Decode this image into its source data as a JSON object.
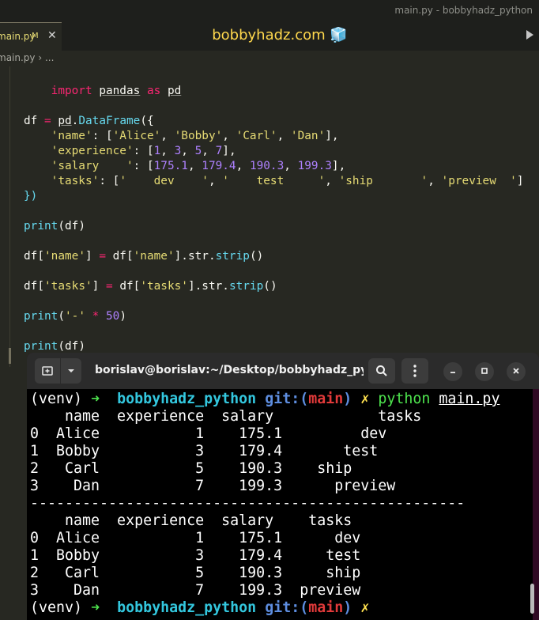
{
  "window": {
    "title": "main.py - bobbyhadz_python"
  },
  "tab": {
    "label": "main.py",
    "modified": "M",
    "close": "✕"
  },
  "brand": "bobbyhadz.com 🧊",
  "breadcrumb": "main.py › ...",
  "code": {
    "l1": [
      "import",
      "pandas",
      "as",
      "pd"
    ],
    "l4a": "df",
    "l4b": "=",
    "l4c": "pd",
    "l4d": ".",
    "l4e": "DataFrame",
    "l4f": "({",
    "l5": [
      "'name'",
      ": [",
      "'Alice'",
      ", ",
      "'Bobby'",
      ", ",
      "'Carl'",
      ", ",
      "'Dan'",
      "],"
    ],
    "l6": [
      "'experience'",
      ": [",
      "1",
      ", ",
      "3",
      ", ",
      "5",
      ", ",
      "7",
      "],"
    ],
    "l7": [
      "'salary    '",
      ": [",
      "175.1",
      ", ",
      "179.4",
      ", ",
      "190.3",
      ", ",
      "199.3",
      "],"
    ],
    "l8": [
      "'tasks'",
      ": [",
      "'    dev    '",
      ", ",
      "'    test     '",
      ", ",
      "'ship       '",
      ", ",
      "'preview  '",
      "]"
    ],
    "l9": "})",
    "l11": [
      "print",
      "(df)"
    ],
    "l13": [
      "df[",
      "'name'",
      "] ",
      "=",
      " df[",
      "'name'",
      "].str.",
      "strip",
      "()"
    ],
    "l15": [
      "df[",
      "'tasks'",
      "] ",
      "=",
      " df[",
      "'tasks'",
      "].str.",
      "strip",
      "()"
    ],
    "l17": [
      "print",
      "(",
      "'-'",
      " ",
      "*",
      " ",
      "50",
      ")"
    ],
    "l19": [
      "print",
      "(df)"
    ]
  },
  "terminal": {
    "title": "borislav@borislav:~/Desktop/bobbyhadz_py...",
    "icons": {
      "new_tab": "plus-icon",
      "dropdown": "chevron-down-icon",
      "search": "search-icon",
      "menu": "kebab-menu-icon",
      "minimize": "minimize-icon",
      "maximize": "maximize-icon",
      "close": "close-icon"
    },
    "prompt": {
      "venv": "(venv)",
      "arrow": "➜",
      "dir": "bobbyhadz_python",
      "git": "git:(",
      "branch": "main",
      "git_close": ")",
      "x": "✗",
      "cmd": "python",
      "arg": "main.py"
    },
    "out1": {
      "header": "    name  experience  salary            tasks",
      "rows": [
        "0  Alice           1    175.1         dev",
        "1  Bobby           3    179.4       test",
        "2   Carl           5    190.3    ship",
        "3    Dan           7    199.3      preview"
      ]
    },
    "separator": "--------------------------------------------------",
    "out2": {
      "header": "    name  experience  salary    tasks",
      "rows": [
        "0  Alice           1    175.1      dev",
        "1  Bobby           3    179.4     test",
        "2   Carl           5    190.3     ship",
        "3    Dan           7    199.3  preview"
      ]
    }
  }
}
